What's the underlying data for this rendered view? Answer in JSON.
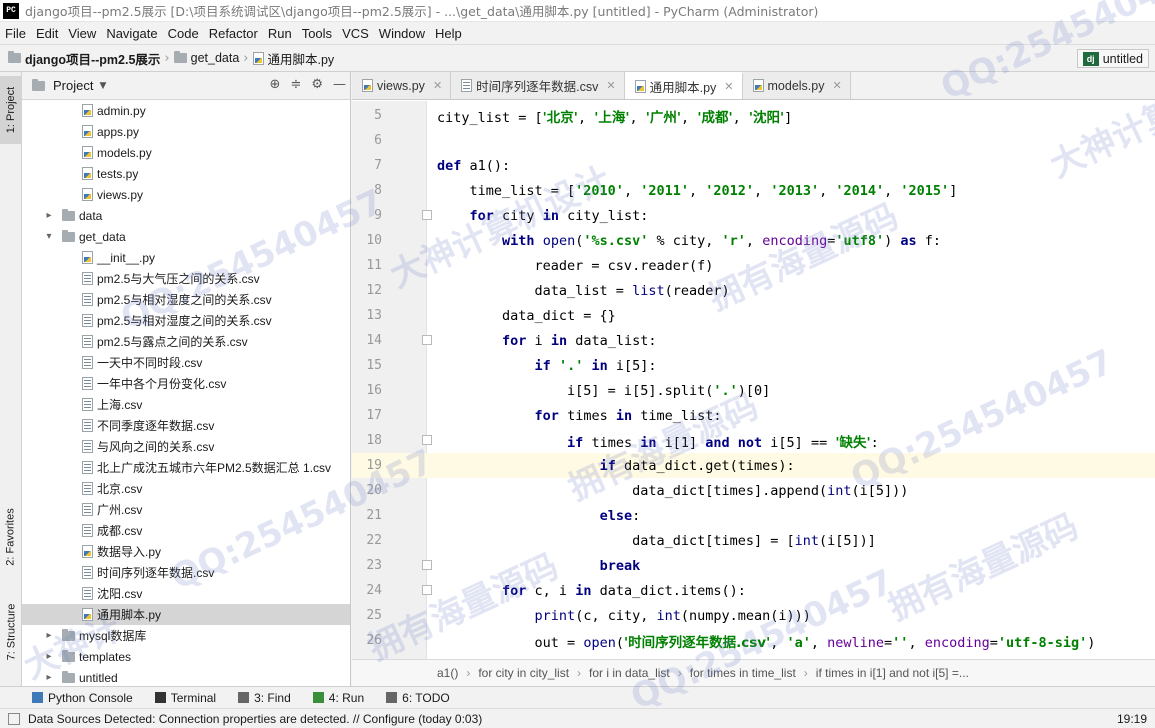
{
  "window": {
    "title": "django项目--pm2.5展示 [D:\\项目系统调试区\\django项目--pm2.5展示] - ...\\get_data\\通用脚本.py [untitled] - PyCharm (Administrator)",
    "app_icon": "PC"
  },
  "menu": [
    "File",
    "Edit",
    "View",
    "Navigate",
    "Code",
    "Refactor",
    "Run",
    "Tools",
    "VCS",
    "Window",
    "Help"
  ],
  "nav": {
    "project": "django项目--pm2.5展示",
    "folder": "get_data",
    "file": "通用脚本.py",
    "run_config": "untitled",
    "run_config_icon": "dj"
  },
  "left_strip": {
    "project_tab": "1: Project",
    "favorites_tab": "2: Favorites",
    "structure_tab": "7: Structure"
  },
  "project_panel": {
    "title": "Project",
    "items": [
      {
        "label": "admin.py",
        "type": "py",
        "depth": 2
      },
      {
        "label": "apps.py",
        "type": "py",
        "depth": 2
      },
      {
        "label": "models.py",
        "type": "py",
        "depth": 2
      },
      {
        "label": "tests.py",
        "type": "py",
        "depth": 2
      },
      {
        "label": "views.py",
        "type": "py",
        "depth": 2
      },
      {
        "label": "data",
        "type": "folder",
        "depth": 1,
        "arrow": "▸"
      },
      {
        "label": "get_data",
        "type": "folder",
        "depth": 1,
        "arrow": "▾"
      },
      {
        "label": "__init__.py",
        "type": "py",
        "depth": 2
      },
      {
        "label": "pm2.5与大气压之间的关系.csv",
        "type": "csv",
        "depth": 2
      },
      {
        "label": "pm2.5与相对湿度之间的关系.csv",
        "type": "csv",
        "depth": 2
      },
      {
        "label": "pm2.5与相对湿度之间的关系.csv",
        "type": "csv",
        "depth": 2
      },
      {
        "label": "pm2.5与露点之间的关系.csv",
        "type": "csv",
        "depth": 2
      },
      {
        "label": "一天中不同时段.csv",
        "type": "csv",
        "depth": 2
      },
      {
        "label": "一年中各个月份变化.csv",
        "type": "csv",
        "depth": 2
      },
      {
        "label": "上海.csv",
        "type": "csv",
        "depth": 2
      },
      {
        "label": "不同季度逐年数据.csv",
        "type": "csv",
        "depth": 2
      },
      {
        "label": "与风向之间的关系.csv",
        "type": "csv",
        "depth": 2
      },
      {
        "label": "北上广成沈五城市六年PM2.5数据汇总 1.csv",
        "type": "csv",
        "depth": 2
      },
      {
        "label": "北京.csv",
        "type": "csv",
        "depth": 2
      },
      {
        "label": "广州.csv",
        "type": "csv",
        "depth": 2
      },
      {
        "label": "成都.csv",
        "type": "csv",
        "depth": 2
      },
      {
        "label": "数据导入.py",
        "type": "py",
        "depth": 2
      },
      {
        "label": "时间序列逐年数据.csv",
        "type": "csv",
        "depth": 2
      },
      {
        "label": "沈阳.csv",
        "type": "csv",
        "depth": 2
      },
      {
        "label": "通用脚本.py",
        "type": "py",
        "depth": 2,
        "selected": true
      },
      {
        "label": "mysql数据库",
        "type": "folder",
        "depth": 1,
        "arrow": "▸"
      },
      {
        "label": "templates",
        "type": "folder",
        "depth": 1,
        "arrow": "▸"
      },
      {
        "label": "untitled",
        "type": "folder",
        "depth": 1,
        "arrow": "▸"
      }
    ]
  },
  "tabs": [
    {
      "label": "views.py",
      "type": "py"
    },
    {
      "label": "时间序列逐年数据.csv",
      "type": "csv"
    },
    {
      "label": "通用脚本.py",
      "type": "py",
      "active": true
    },
    {
      "label": "models.py",
      "type": "py"
    }
  ],
  "code_lines": [
    {
      "n": "5",
      "html": "city_list = [<span class=\"cjk\">'北京'</span>, <span class=\"cjk\">'上海'</span>, <span class=\"cjk\">'广州'</span>, <span class=\"cjk\">'成都'</span>, <span class=\"cjk\">'沈阳'</span>]"
    },
    {
      "n": "6",
      "html": ""
    },
    {
      "n": "7",
      "html": "<span class=\"kw\">def</span> a1():"
    },
    {
      "n": "8",
      "html": "    time_list = [<span class=\"str\">'2010'</span>, <span class=\"str\">'2011'</span>, <span class=\"str\">'2012'</span>, <span class=\"str\">'2013'</span>, <span class=\"str\">'2014'</span>, <span class=\"str\">'2015'</span>]"
    },
    {
      "n": "9",
      "html": "    <span class=\"kw\">for</span> city <span class=\"kw\">in</span> city_list:"
    },
    {
      "n": "10",
      "html": "        <span class=\"kw\">with</span> <span class=\"builtin\">open</span>(<span class=\"str\">'%s.csv'</span> % city, <span class=\"str\">'r'</span>, <span class=\"param\">encoding</span>=<span class=\"str\">'utf8'</span>) <span class=\"kw\">as</span> f:"
    },
    {
      "n": "11",
      "html": "            reader = csv.reader(f)"
    },
    {
      "n": "12",
      "html": "            data_list = <span class=\"builtin\">list</span>(reader)"
    },
    {
      "n": "13",
      "html": "        data_dict = {}"
    },
    {
      "n": "14",
      "html": "        <span class=\"kw\">for</span> i <span class=\"kw\">in</span> data_list:"
    },
    {
      "n": "15",
      "html": "            <span class=\"kw\">if</span> <span class=\"str\">'.'</span> <span class=\"kw\">in</span> i[5]:"
    },
    {
      "n": "16",
      "html": "                i[5] = i[5].split(<span class=\"str\">'.'</span>)[0]"
    },
    {
      "n": "17",
      "html": "            <span class=\"kw\">for</span> times <span class=\"kw\">in</span> time_list:"
    },
    {
      "n": "18",
      "html": "                <span class=\"kw\">if</span> times <span class=\"kw\">in</span> i[1] <span class=\"kw\">and not</span> i[5] == <span class=\"cjk\">'缺失'</span>:"
    },
    {
      "n": "19",
      "html": "                    <span class=\"kw\">if</span> data_dict.get(times):",
      "current": true
    },
    {
      "n": "20",
      "html": "                        data_dict[times].append(<span class=\"builtin\">int</span>(i[5]))"
    },
    {
      "n": "21",
      "html": "                    <span class=\"kw\">else</span>:"
    },
    {
      "n": "22",
      "html": "                        data_dict[times] = [<span class=\"builtin\">int</span>(i[5])]"
    },
    {
      "n": "23",
      "html": "                    <span class=\"kw\">break</span>"
    },
    {
      "n": "24",
      "html": "        <span class=\"kw\">for</span> c, i <span class=\"kw\">in</span> data_dict.items():"
    },
    {
      "n": "25",
      "html": "            <span class=\"builtin\">print</span>(c, city, <span class=\"builtin\">int</span>(numpy.mean(i)))"
    },
    {
      "n": "26",
      "html": "            out = <span class=\"builtin\">open</span>(<span class=\"cjk\">'时间序列逐年数据.csv'</span>, <span class=\"str\">'a'</span>, <span class=\"param\">newline</span>=<span class=\"str\">''</span>, <span class=\"param\">encoding</span>=<span class=\"str\">'utf-8-sig'</span>)"
    }
  ],
  "breadcrumbs": [
    "a1()",
    "for city in city_list",
    "for i in data_list",
    "for times in time_list",
    "if times in i[1] and not i[5] =..."
  ],
  "tool_windows": [
    "Python Console",
    "Terminal",
    "3: Find",
    "4: Run",
    "6: TODO"
  ],
  "status": {
    "message": "Data Sources Detected: Connection properties are detected. // Configure (today 0:03)",
    "time": "19:19"
  },
  "watermarks": [
    "QQ:254540457",
    "大神计算机设计",
    "拥有海量源码",
    "QQ:254540457",
    "大神计算机设计",
    "拥有海量源码",
    "QQ:254540457",
    "拥有海量源码",
    "QQ:254540457",
    "大神计",
    "QQ:254540457",
    "拥有海量源码"
  ]
}
